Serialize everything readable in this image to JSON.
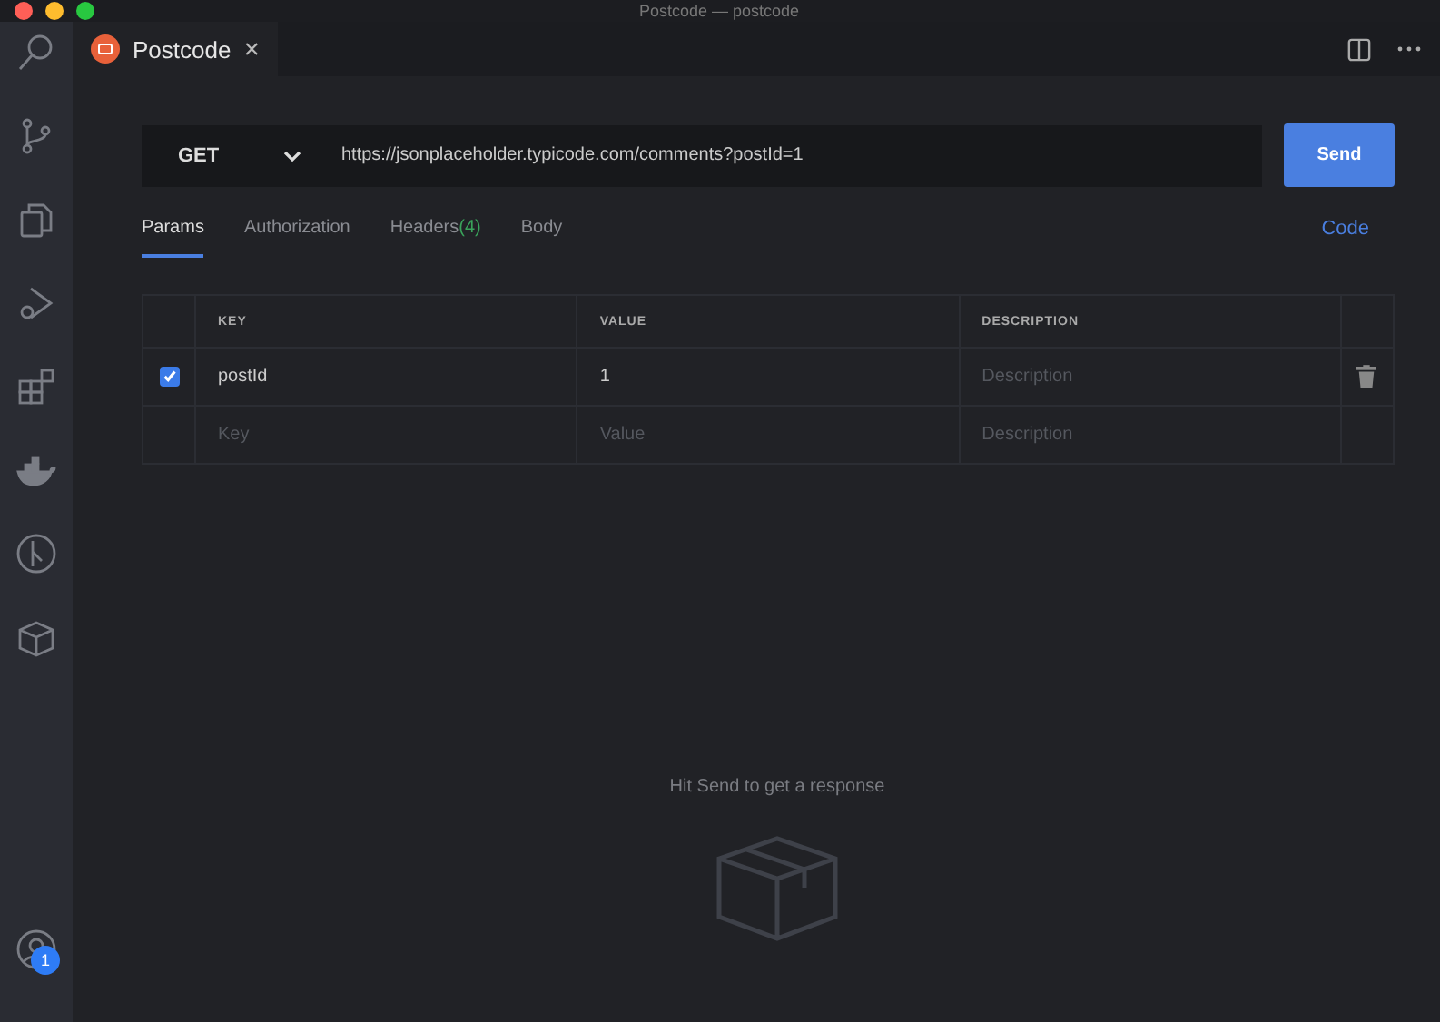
{
  "window": {
    "title": "Postcode — postcode"
  },
  "activity_bar": {
    "items": [
      {
        "selected": false
      },
      {
        "selected": false
      },
      {
        "selected": false
      },
      {
        "selected": false
      },
      {
        "selected": false
      },
      {
        "selected": false
      },
      {
        "selected": false
      },
      {
        "selected": false
      }
    ],
    "account_badge": "1"
  },
  "editor_tabs": [
    {
      "label": "Postcode",
      "close": "×",
      "selected": true
    }
  ],
  "request": {
    "method": "GET",
    "url": "https://jsonplaceholder.typicode.com/comments?postId=1",
    "send": "Send"
  },
  "tabs": [
    {
      "label": "Params",
      "selected": true
    },
    {
      "label": "Authorization",
      "selected": false
    },
    {
      "label": "Headers",
      "count": "(4)",
      "selected": false
    },
    {
      "label": "Body",
      "selected": false
    }
  ],
  "code_link": "Code",
  "params": {
    "columns": [
      "KEY",
      "VALUE",
      "DESCRIPTION"
    ],
    "rows": [
      {
        "checked": true,
        "key": "postId",
        "value": "1",
        "description": {
          "placeholder": "Description"
        }
      },
      {
        "key": {
          "placeholder": "Key"
        },
        "value": {
          "placeholder": "Value"
        },
        "description": {
          "placeholder": "Description"
        }
      }
    ]
  },
  "response": {
    "message": "Hit Send to get a response"
  }
}
